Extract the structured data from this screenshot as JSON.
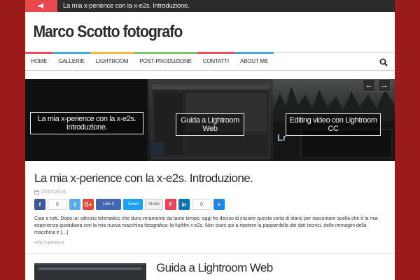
{
  "topbar": {
    "ticker": "La mia x-perience con la x-e2s. Introduzione."
  },
  "site": {
    "title": "Marco Scotto fotografo"
  },
  "nav": {
    "items": [
      {
        "label": "HOME",
        "color": "#e94f5f"
      },
      {
        "label": "GALLERIE",
        "color": "#4aa7d8"
      },
      {
        "label": "LIGHTROOM",
        "color": "#f2b843"
      },
      {
        "label": "POST-PRODUZIONE",
        "color": "#7bc36c"
      },
      {
        "label": "CONTATTI",
        "color": "#e94f5f"
      },
      {
        "label": "ABOUT ME",
        "color": "#4aa7d8"
      }
    ]
  },
  "slider": {
    "slides": [
      {
        "caption": "La mia x-perience con la x-e2s. Introduzione."
      },
      {
        "caption": "Guida a Lightroom Web"
      },
      {
        "caption": "Editing video con Lightroom CC"
      }
    ],
    "prev_label": "←",
    "next_label": "→"
  },
  "post1": {
    "title": "La mia x-perience con la x-e2s. Introduzione.",
    "date": "25/03/2016",
    "share": {
      "facebook_count": "0",
      "like_label": "Like 0",
      "tweet_label": "Tweet",
      "share_label": "Share",
      "linkedin_count": "0"
    },
    "excerpt": "Ciao a tutti. Dopo un silenzio telematico che dura veramente da tanto tempo, oggi ho deciso di iniziare questa sorta di diario per raccontare quella che è la mia esperienza quotidiana con la mia nuova macchina fotografica: la fujifilm x-e2s. Non starò qui a ripetere la pappardella dei dati tecnici, delle immagini della macchina e […]",
    "category": "My X-perience"
  },
  "post2": {
    "title": "Guida a Lightroom Web"
  },
  "colors": {
    "brand_red": "#9b1b1b",
    "accent": "#e8494f"
  }
}
